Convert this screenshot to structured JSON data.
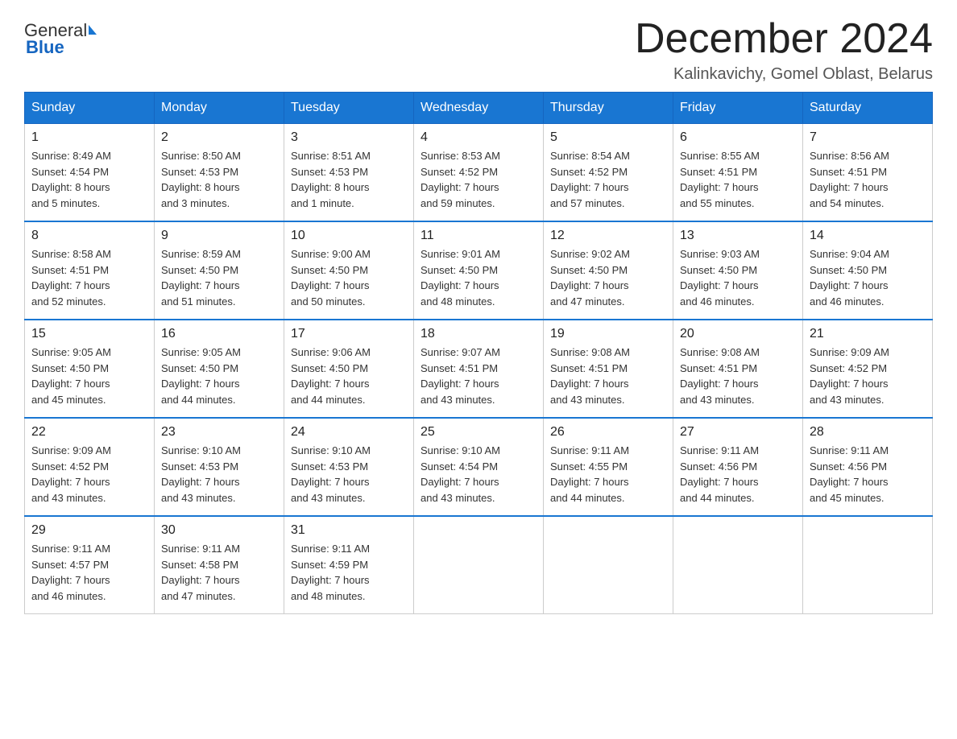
{
  "header": {
    "logo_general": "General",
    "logo_blue": "Blue",
    "month_title": "December 2024",
    "location": "Kalinkavichy, Gomel Oblast, Belarus"
  },
  "days_of_week": [
    "Sunday",
    "Monday",
    "Tuesday",
    "Wednesday",
    "Thursday",
    "Friday",
    "Saturday"
  ],
  "weeks": [
    [
      {
        "day": "1",
        "sunrise": "8:49 AM",
        "sunset": "4:54 PM",
        "daylight": "8 hours and 5 minutes."
      },
      {
        "day": "2",
        "sunrise": "8:50 AM",
        "sunset": "4:53 PM",
        "daylight": "8 hours and 3 minutes."
      },
      {
        "day": "3",
        "sunrise": "8:51 AM",
        "sunset": "4:53 PM",
        "daylight": "8 hours and 1 minute."
      },
      {
        "day": "4",
        "sunrise": "8:53 AM",
        "sunset": "4:52 PM",
        "daylight": "7 hours and 59 minutes."
      },
      {
        "day": "5",
        "sunrise": "8:54 AM",
        "sunset": "4:52 PM",
        "daylight": "7 hours and 57 minutes."
      },
      {
        "day": "6",
        "sunrise": "8:55 AM",
        "sunset": "4:51 PM",
        "daylight": "7 hours and 55 minutes."
      },
      {
        "day": "7",
        "sunrise": "8:56 AM",
        "sunset": "4:51 PM",
        "daylight": "7 hours and 54 minutes."
      }
    ],
    [
      {
        "day": "8",
        "sunrise": "8:58 AM",
        "sunset": "4:51 PM",
        "daylight": "7 hours and 52 minutes."
      },
      {
        "day": "9",
        "sunrise": "8:59 AM",
        "sunset": "4:50 PM",
        "daylight": "7 hours and 51 minutes."
      },
      {
        "day": "10",
        "sunrise": "9:00 AM",
        "sunset": "4:50 PM",
        "daylight": "7 hours and 50 minutes."
      },
      {
        "day": "11",
        "sunrise": "9:01 AM",
        "sunset": "4:50 PM",
        "daylight": "7 hours and 48 minutes."
      },
      {
        "day": "12",
        "sunrise": "9:02 AM",
        "sunset": "4:50 PM",
        "daylight": "7 hours and 47 minutes."
      },
      {
        "day": "13",
        "sunrise": "9:03 AM",
        "sunset": "4:50 PM",
        "daylight": "7 hours and 46 minutes."
      },
      {
        "day": "14",
        "sunrise": "9:04 AM",
        "sunset": "4:50 PM",
        "daylight": "7 hours and 46 minutes."
      }
    ],
    [
      {
        "day": "15",
        "sunrise": "9:05 AM",
        "sunset": "4:50 PM",
        "daylight": "7 hours and 45 minutes."
      },
      {
        "day": "16",
        "sunrise": "9:05 AM",
        "sunset": "4:50 PM",
        "daylight": "7 hours and 44 minutes."
      },
      {
        "day": "17",
        "sunrise": "9:06 AM",
        "sunset": "4:50 PM",
        "daylight": "7 hours and 44 minutes."
      },
      {
        "day": "18",
        "sunrise": "9:07 AM",
        "sunset": "4:51 PM",
        "daylight": "7 hours and 43 minutes."
      },
      {
        "day": "19",
        "sunrise": "9:08 AM",
        "sunset": "4:51 PM",
        "daylight": "7 hours and 43 minutes."
      },
      {
        "day": "20",
        "sunrise": "9:08 AM",
        "sunset": "4:51 PM",
        "daylight": "7 hours and 43 minutes."
      },
      {
        "day": "21",
        "sunrise": "9:09 AM",
        "sunset": "4:52 PM",
        "daylight": "7 hours and 43 minutes."
      }
    ],
    [
      {
        "day": "22",
        "sunrise": "9:09 AM",
        "sunset": "4:52 PM",
        "daylight": "7 hours and 43 minutes."
      },
      {
        "day": "23",
        "sunrise": "9:10 AM",
        "sunset": "4:53 PM",
        "daylight": "7 hours and 43 minutes."
      },
      {
        "day": "24",
        "sunrise": "9:10 AM",
        "sunset": "4:53 PM",
        "daylight": "7 hours and 43 minutes."
      },
      {
        "day": "25",
        "sunrise": "9:10 AM",
        "sunset": "4:54 PM",
        "daylight": "7 hours and 43 minutes."
      },
      {
        "day": "26",
        "sunrise": "9:11 AM",
        "sunset": "4:55 PM",
        "daylight": "7 hours and 44 minutes."
      },
      {
        "day": "27",
        "sunrise": "9:11 AM",
        "sunset": "4:56 PM",
        "daylight": "7 hours and 44 minutes."
      },
      {
        "day": "28",
        "sunrise": "9:11 AM",
        "sunset": "4:56 PM",
        "daylight": "7 hours and 45 minutes."
      }
    ],
    [
      {
        "day": "29",
        "sunrise": "9:11 AM",
        "sunset": "4:57 PM",
        "daylight": "7 hours and 46 minutes."
      },
      {
        "day": "30",
        "sunrise": "9:11 AM",
        "sunset": "4:58 PM",
        "daylight": "7 hours and 47 minutes."
      },
      {
        "day": "31",
        "sunrise": "9:11 AM",
        "sunset": "4:59 PM",
        "daylight": "7 hours and 48 minutes."
      },
      null,
      null,
      null,
      null
    ]
  ],
  "labels": {
    "sunrise": "Sunrise:",
    "sunset": "Sunset:",
    "daylight": "Daylight:"
  }
}
